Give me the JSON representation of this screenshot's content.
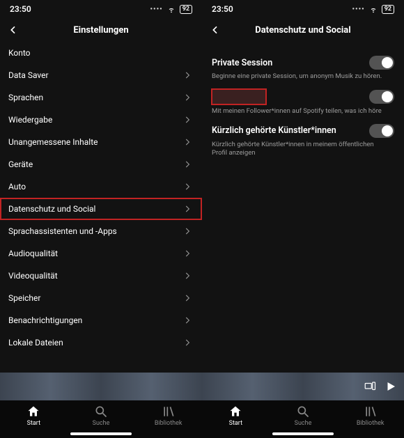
{
  "status": {
    "time": "23:50",
    "battery": "92"
  },
  "left": {
    "title": "Einstellungen",
    "rows": {
      "r0": "Konto",
      "r1": "Data Saver",
      "r2": "Sprachen",
      "r3": "Wiedergabe",
      "r4": "Unangemessene Inhalte",
      "r5": "Geräte",
      "r6": "Auto",
      "r7": "Datenschutz und Social",
      "r8": "Sprachassistenten und -Apps",
      "r9": "Audioqualität",
      "r10": "Videoqualität",
      "r11": "Speicher",
      "r12": "Benachrichtigungen",
      "r13": "Lokale Dateien"
    }
  },
  "right": {
    "title": "Datenschutz und Social",
    "privateSession": {
      "label": "Private Session",
      "desc": "Beginne eine private Session, um anonym Musik zu hören."
    },
    "listening": {
      "desc": "Mit meinen Follower*innen auf Spotify teilen, was ich höre"
    },
    "recent": {
      "label": "Kürzlich gehörte Künstler*innen",
      "desc": "Kürzlich gehörte Künstler*innen in meinem öffentlichen Profil anzeigen"
    }
  },
  "nav": {
    "start": "Start",
    "suche": "Suche",
    "bib": "Bibliothek"
  }
}
